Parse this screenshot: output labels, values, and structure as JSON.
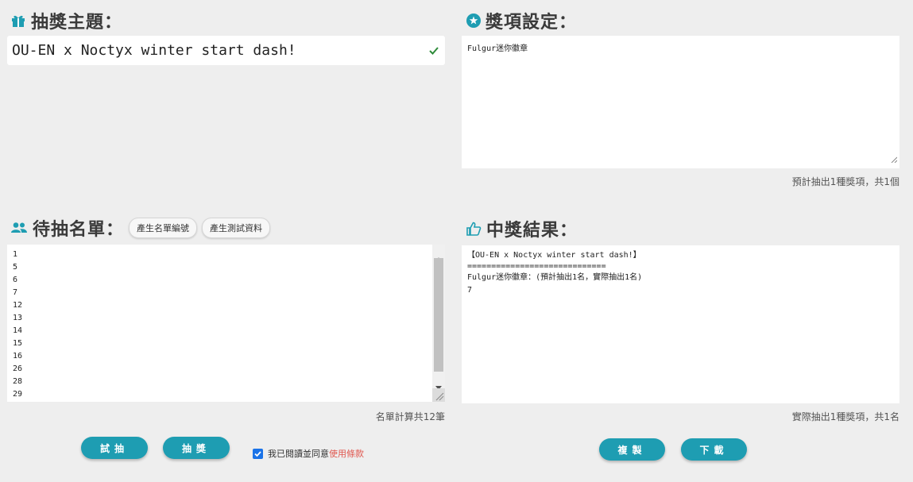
{
  "theme": {
    "title": "抽獎主題：",
    "input_value": "OU-EN x Noctyx winter start dash!"
  },
  "prizes": {
    "title": "獎項設定：",
    "textarea_value": "Fulgur迷你徽章",
    "summary": "預計抽出1種獎項，共1個"
  },
  "candidates": {
    "title": "待抽名單：",
    "btn_gen_list": "產生名單編號",
    "btn_gen_test": "產生測試資料",
    "items": [
      "1",
      "5",
      "6",
      "7",
      "12",
      "13",
      "14",
      "15",
      "16",
      "26",
      "28",
      "29"
    ],
    "count_text": "名單計算共12筆"
  },
  "results": {
    "title": "中獎結果：",
    "lines": [
      "【OU-EN x Noctyx winter start dash!】",
      "=============================",
      "Fulgur迷你徽章：(預計抽出1名，實際抽出1名)",
      "7"
    ],
    "summary": "實際抽出1種獎項，共1名"
  },
  "actions": {
    "trial": "試抽",
    "draw": "抽獎",
    "agree_text": "我已閱讀並同意",
    "terms_link": "使用條款",
    "copy": "複製",
    "download": "下載"
  },
  "colors": {
    "accent": "#1e9db2",
    "link": "#e0574f",
    "check": "#2e8b3a"
  },
  "icons": [
    "gift-icon",
    "star-circle-icon",
    "users-icon",
    "thumbs-up-icon",
    "check-icon"
  ]
}
